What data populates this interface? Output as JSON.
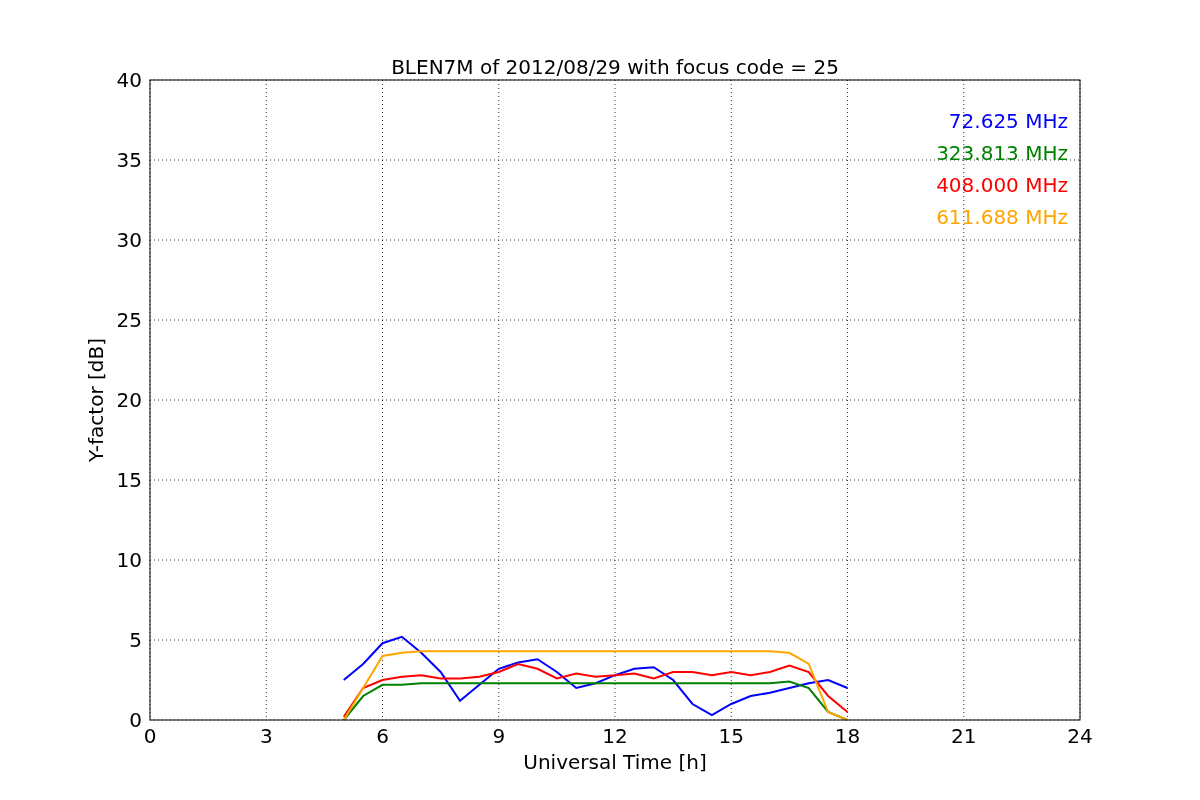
{
  "plot": {
    "chart_data": {
      "type": "line",
      "title": "BLEN7M of 2012/08/29 with focus code = 25",
      "xlabel": "Universal Time [h]",
      "ylabel": "Y-factor [dB]",
      "x": [
        5,
        5.5,
        6,
        6.5,
        7,
        7.5,
        8,
        8.5,
        9,
        9.5,
        10,
        10.5,
        11,
        11.5,
        12,
        12.5,
        13,
        13.5,
        14,
        14.5,
        15,
        15.5,
        16,
        16.5,
        17,
        17.5,
        18
      ],
      "series": [
        {
          "name": "72.625 MHz",
          "color": "#0000ff",
          "values": [
            2.5,
            3.5,
            4.8,
            5.2,
            4.2,
            3.0,
            1.2,
            2.2,
            3.2,
            3.6,
            3.8,
            3.0,
            2.0,
            2.3,
            2.8,
            3.2,
            3.3,
            2.5,
            1.0,
            0.3,
            1.0,
            1.5,
            1.7,
            2.0,
            2.3,
            2.5,
            2.0
          ]
        },
        {
          "name": "323.813 MHz",
          "color": "#008000",
          "values": [
            0,
            1.5,
            2.2,
            2.2,
            2.3,
            2.3,
            2.3,
            2.3,
            2.3,
            2.3,
            2.3,
            2.3,
            2.3,
            2.3,
            2.3,
            2.3,
            2.3,
            2.3,
            2.3,
            2.3,
            2.3,
            2.3,
            2.3,
            2.4,
            2.0,
            0.5,
            0
          ]
        },
        {
          "name": "408.000 MHz",
          "color": "#ff0000",
          "values": [
            0.2,
            2.0,
            2.5,
            2.7,
            2.8,
            2.6,
            2.6,
            2.7,
            3.0,
            3.5,
            3.2,
            2.6,
            2.9,
            2.7,
            2.8,
            2.9,
            2.6,
            3.0,
            3.0,
            2.8,
            3.0,
            2.8,
            3.0,
            3.4,
            3.0,
            1.5,
            0.5
          ]
        },
        {
          "name": "611.688 MHz",
          "color": "#ffa500",
          "values": [
            0,
            2.0,
            4.0,
            4.2,
            4.3,
            4.3,
            4.3,
            4.3,
            4.3,
            4.3,
            4.3,
            4.3,
            4.3,
            4.3,
            4.3,
            4.3,
            4.3,
            4.3,
            4.3,
            4.3,
            4.3,
            4.3,
            4.3,
            4.2,
            3.5,
            0.5,
            0
          ]
        }
      ],
      "grid": true,
      "xlim": [
        0,
        24
      ],
      "ylim": [
        0,
        40
      ],
      "xticks": [
        0,
        3,
        6,
        9,
        12,
        15,
        18,
        21,
        24
      ],
      "yticks": [
        0,
        5,
        10,
        15,
        20,
        25,
        30,
        35,
        40
      ]
    }
  }
}
